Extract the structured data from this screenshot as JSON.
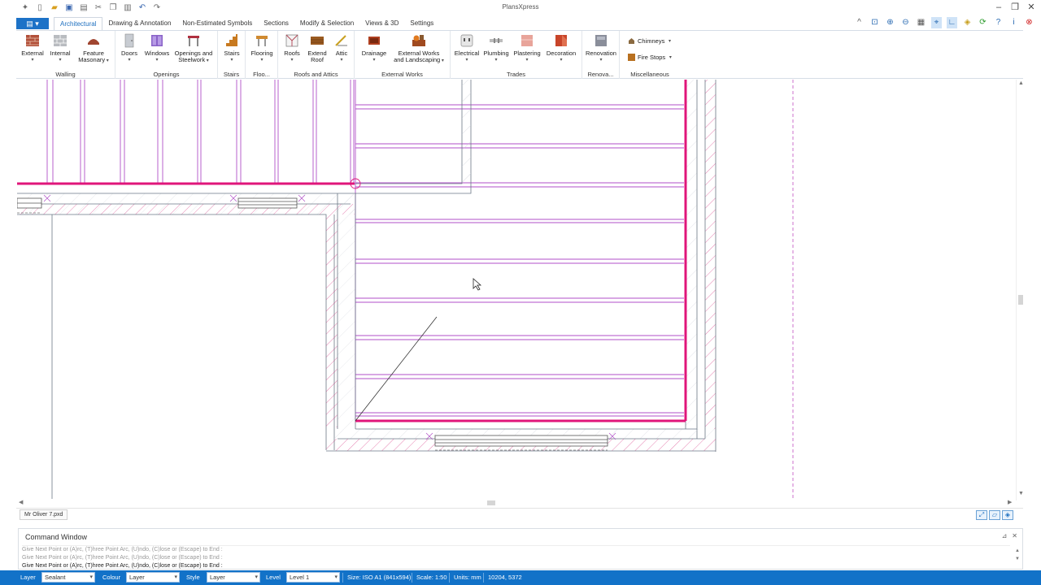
{
  "app": {
    "title": "PlansXpress"
  },
  "tabs": [
    "Architectural",
    "Drawing & Annotation",
    "Non-Estimated Symbols",
    "Sections",
    "Modify & Selection",
    "Views & 3D",
    "Settings"
  ],
  "ribbon": {
    "groups": {
      "walling": "Walling",
      "openings": "Openings",
      "stairs": "Stairs",
      "flooring": "Floo...",
      "roofs": "Roofs and Attics",
      "external_works": "External Works",
      "trades": "Trades",
      "renovation": "Renova...",
      "misc": "Miscellaneous"
    },
    "buttons": {
      "external": "External",
      "internal": "Internal",
      "feature1": "Feature",
      "feature2": "Masonary",
      "doors": "Doors",
      "windows": "Windows",
      "openings1": "Openings and",
      "openings2": "Steelwork",
      "stairs": "Stairs",
      "flooring": "Flooring",
      "roofs": "Roofs",
      "extend1": "Extend",
      "extend2": "Roof",
      "attic": "Attic",
      "drainage": "Drainage",
      "extworks1": "External Works",
      "extworks2": "and Landscaping",
      "electrical": "Electrical",
      "plumbing": "Plumbing",
      "plastering": "Plastering",
      "decoration": "Decoration",
      "renovation": "Renovation",
      "chimneys": "Chimneys",
      "firestops": "Fire Stops"
    }
  },
  "document": {
    "tab": "Mr Oliver 7.pxd"
  },
  "command_window": {
    "title": "Command Window",
    "lines": [
      "Give Next Point or (A)rc, (T)hree Point Arc, (U)ndo, (C)lose or (Escape) to End :",
      "Give Next Point or (A)rc, (T)hree Point Arc, (U)ndo, (C)lose or (Escape) to End :",
      "Give Next Point or (A)rc, (T)hree Point Arc, (U)ndo, (C)lose or (Escape) to End :"
    ]
  },
  "status": {
    "layer_label": "Layer",
    "layer_value": "Sealant",
    "colour_label": "Colour",
    "colour_value": "Layer",
    "style_label": "Style",
    "style_value": "Layer",
    "level_label": "Level",
    "level_value": "Level 1",
    "size": "Size: ISO A1 (841x594)",
    "scale": "Scale: 1:50",
    "units": "Units: mm",
    "coords": "10204, 5372"
  },
  "colors": {
    "accent": "#1272c8",
    "magenta": "#e0157a",
    "purple": "#b04fc8",
    "wall": "#4a5a6a"
  }
}
